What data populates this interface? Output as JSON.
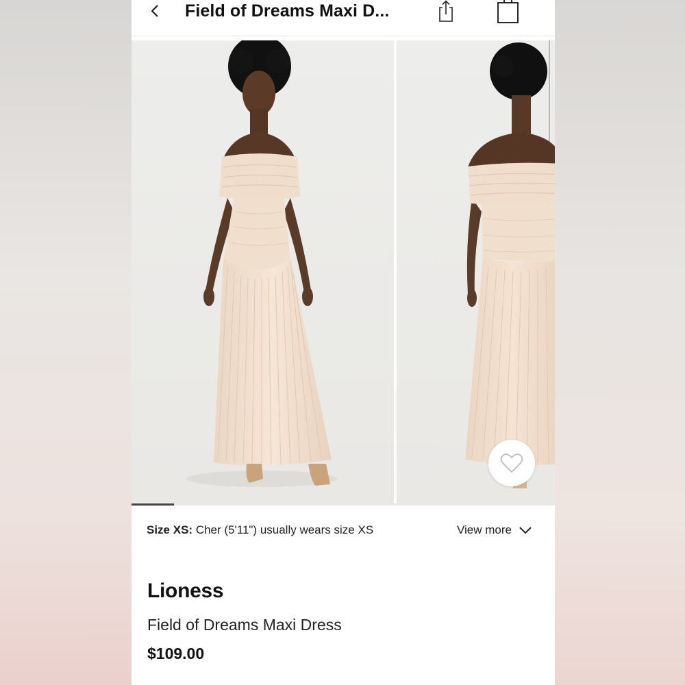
{
  "header": {
    "title": "Field of Dreams Maxi D...",
    "back_icon": "chevron-left-icon",
    "share_icon": "share-icon",
    "bag_icon": "shopping-bag-icon"
  },
  "gallery": {
    "images": [
      {
        "name": "front view",
        "alt": "Model wearing off-shoulder pleated maxi dress, front view"
      },
      {
        "name": "back view",
        "alt": "Model wearing off-shoulder pleated maxi dress, back view"
      }
    ],
    "progress": 0.1,
    "favorite_icon": "heart-icon"
  },
  "size_info": {
    "label": "Size XS:",
    "text": " Cher (5'11\") usually wears size XS",
    "view_more": "View more",
    "view_more_icon": "chevron-down-icon"
  },
  "product": {
    "brand": "Lioness",
    "name": "Field of Dreams Maxi Dress",
    "price": "$109.00"
  },
  "colors": {
    "dress": "#f2e0cf",
    "skin": "#5a3a28",
    "background": "#ebeae7",
    "text": "#111111"
  }
}
